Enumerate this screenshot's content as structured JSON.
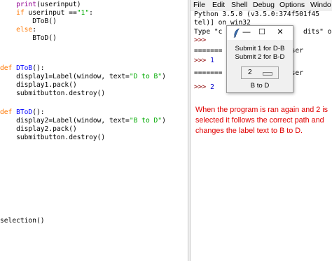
{
  "editor": {
    "code_lines": [
      {
        "indent": "    ",
        "parts": [
          {
            "t": "print",
            "c": "bi"
          },
          {
            "t": "(userinput)",
            "c": ""
          }
        ]
      },
      {
        "indent": "    ",
        "parts": [
          {
            "t": "if",
            "c": "kw"
          },
          {
            "t": " userinput ==",
            "c": ""
          },
          {
            "t": "\"1\"",
            "c": "str"
          },
          {
            "t": ":",
            "c": ""
          }
        ]
      },
      {
        "indent": "        ",
        "parts": [
          {
            "t": "DToB()",
            "c": ""
          }
        ]
      },
      {
        "indent": "    ",
        "parts": [
          {
            "t": "else",
            "c": "kw"
          },
          {
            "t": ":",
            "c": ""
          }
        ]
      },
      {
        "indent": "        ",
        "parts": [
          {
            "t": "BToD()",
            "c": ""
          }
        ]
      },
      {
        "indent": "",
        "parts": [
          {
            "t": "def",
            "c": "kw"
          },
          {
            "t": " ",
            "c": ""
          },
          {
            "t": "DToB",
            "c": "fn"
          },
          {
            "t": "():",
            "c": ""
          }
        ]
      },
      {
        "indent": "    ",
        "parts": [
          {
            "t": "display1=Label(window, text=",
            "c": ""
          },
          {
            "t": "\"D to B\"",
            "c": "str"
          },
          {
            "t": ")",
            "c": ""
          }
        ]
      },
      {
        "indent": "    ",
        "parts": [
          {
            "t": "display1.pack()",
            "c": ""
          }
        ]
      },
      {
        "indent": "    ",
        "parts": [
          {
            "t": "submitbutton.destroy()",
            "c": ""
          }
        ]
      },
      {
        "indent": "",
        "parts": [
          {
            "t": "def",
            "c": "kw"
          },
          {
            "t": " ",
            "c": ""
          },
          {
            "t": "BToD",
            "c": "fn"
          },
          {
            "t": "():",
            "c": ""
          }
        ]
      },
      {
        "indent": "    ",
        "parts": [
          {
            "t": "display2=Label(window, text=",
            "c": ""
          },
          {
            "t": "\"B to D\"",
            "c": "str"
          },
          {
            "t": ")",
            "c": ""
          }
        ]
      },
      {
        "indent": "    ",
        "parts": [
          {
            "t": "display2.pack()",
            "c": ""
          }
        ]
      },
      {
        "indent": "    ",
        "parts": [
          {
            "t": "submitbutton.destroy()",
            "c": ""
          }
        ]
      },
      {
        "indent": "",
        "parts": [
          {
            "t": "selection()",
            "c": ""
          }
        ]
      }
    ]
  },
  "shell": {
    "menu": [
      "File",
      "Edit",
      "Shell",
      "Debug",
      "Options",
      "Windo"
    ],
    "lines": [
      {
        "parts": [
          {
            "t": "Python 3.5.0 (v3.5.0:374f501f45",
            "c": ""
          }
        ]
      },
      {
        "parts": [
          {
            "t": "tel)] on win32",
            "c": ""
          }
        ]
      },
      {
        "parts": [
          {
            "t": "Type \"c",
            "c": ""
          },
          {
            "t": "                    ",
            "c": ""
          },
          {
            "t": "dits\" or",
            "c": ""
          }
        ]
      },
      {
        "parts": [
          {
            "t": ">>> ",
            "c": "prompt"
          }
        ]
      },
      {
        "parts": [
          {
            "t": "=======",
            "c": ""
          },
          {
            "t": "           ",
            "c": ""
          },
          {
            "t": ": C:\\User",
            "c": ""
          }
        ]
      },
      {
        "parts": [
          {
            "t": ">>> ",
            "c": "prompt"
          },
          {
            "t": "1",
            "c": "out-blue"
          }
        ]
      },
      {
        "parts": [
          {
            "t": "=======",
            "c": ""
          },
          {
            "t": "           ",
            "c": ""
          },
          {
            "t": ": C:\\User",
            "c": ""
          }
        ]
      },
      {
        "parts": [
          {
            "t": ">>> ",
            "c": "prompt"
          },
          {
            "t": "2",
            "c": "out-blue"
          }
        ]
      }
    ],
    "note": "When the program is ran again and 2 is selected it follows the correct path and changes the label text to B to D."
  },
  "dialog": {
    "minimize_glyph": "—",
    "maximize_glyph": "☐",
    "close_glyph": "✕",
    "label1": "Submit 1 for D-B",
    "label2": "Submit 2 for B-D",
    "option_value": "2",
    "result_label": "B to D"
  }
}
